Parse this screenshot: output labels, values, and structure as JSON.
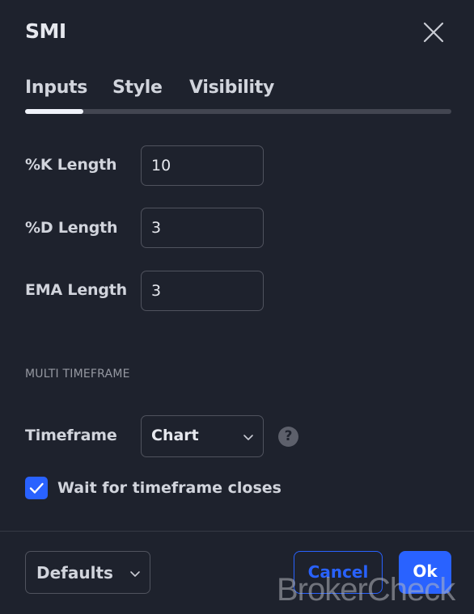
{
  "dialog": {
    "title": "SMI"
  },
  "tabs": [
    {
      "label": "Inputs",
      "active": true
    },
    {
      "label": "Style",
      "active": false
    },
    {
      "label": "Visibility",
      "active": false
    }
  ],
  "inputs": {
    "k_length": {
      "label": "%K Length",
      "value": "10"
    },
    "d_length": {
      "label": "%D Length",
      "value": "3"
    },
    "ema_length": {
      "label": "EMA Length",
      "value": "3"
    }
  },
  "multi_timeframe": {
    "section_title": "MULTI TIMEFRAME",
    "timeframe_label": "Timeframe",
    "timeframe_value": "Chart",
    "help_glyph": "?",
    "wait_label": "Wait for timeframe closes",
    "wait_checked": true
  },
  "footer": {
    "defaults_label": "Defaults",
    "cancel_label": "Cancel",
    "ok_label": "Ok"
  },
  "watermark": "BrokerCheck",
  "icons": {
    "close": "close-icon",
    "chevron": "chevron-down-icon",
    "help": "question-circle-icon",
    "check": "checkmark-icon"
  },
  "colors": {
    "background": "#1e222d",
    "accent": "#2962ff",
    "border": "#50535e",
    "text": "#d1d4dc",
    "muted": "#9598a1"
  }
}
